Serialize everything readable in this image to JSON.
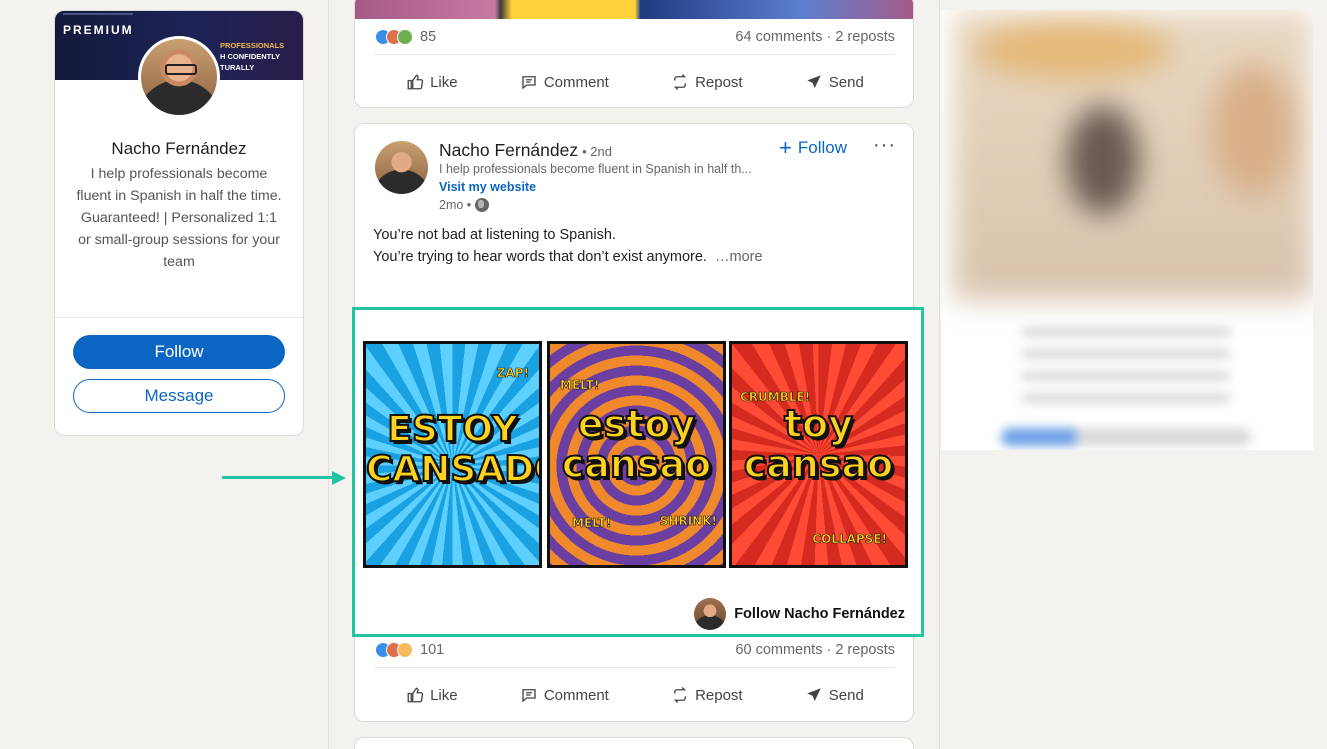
{
  "profile_card": {
    "banner_label": "PREMIUM",
    "banner_lines": [
      "PROFESSIONALS",
      "H CONFIDENTLY",
      "TURALLY"
    ],
    "name": "Nacho Fernández",
    "bio": "I help professionals become fluent in Spanish in half the time. Guaranteed! | Personalized 1:1 or small-group sessions for your team",
    "follow_label": "Follow",
    "message_label": "Message"
  },
  "prev_post": {
    "reactions_count": "85",
    "stats": "64 comments · 2 reposts",
    "actions": {
      "like": "Like",
      "comment": "Comment",
      "repost": "Repost",
      "send": "Send"
    }
  },
  "post": {
    "author_name": "Nacho Fernández",
    "degree": "• 2nd",
    "headline": "I help professionals become fluent in Spanish in half th...",
    "visit_link": "Visit my website",
    "time": "2mo •",
    "follow_label": "Follow",
    "follow_icon": "+",
    "more_icon": "···",
    "text_line1": "You’re not bad at listening to Spanish.",
    "text_line2": "You’re trying to hear words that don’t exist anymore.",
    "more_label": "…more",
    "media": {
      "panels": [
        {
          "main": "ESTOY CANSADO",
          "tags": [
            "ZAP!"
          ]
        },
        {
          "main": "estoy cansao",
          "tags": [
            "MELT!",
            "MELT!",
            "SHRINK!"
          ]
        },
        {
          "main": "toy cansao",
          "tags": [
            "CRUMBLE!",
            "COLLAPSE!"
          ]
        }
      ],
      "footer_label": "Follow Nacho Fernández"
    },
    "reactions_count": "101",
    "stats": "60 comments · 2 reposts",
    "actions": {
      "like": "Like",
      "comment": "Comment",
      "repost": "Repost",
      "send": "Send"
    }
  },
  "colors": {
    "brand_blue": "#0a66c2",
    "highlight_teal": "#23c4a4"
  }
}
